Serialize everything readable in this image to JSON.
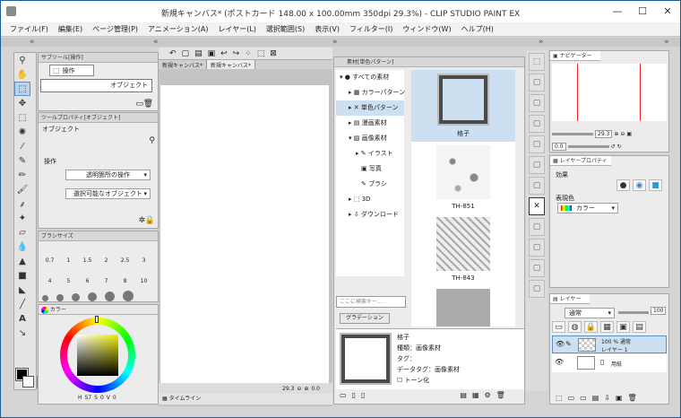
{
  "titlebar": {
    "title": "新規キャンバス* (ポストカード 148.00 x 100.00mm 350dpi 29.3%) - CLIP STUDIO PAINT EX",
    "minimize": "—",
    "maximize": "☐",
    "close": "✕"
  },
  "menu": [
    "ファイル(F)",
    "編集(E)",
    "ページ管理(P)",
    "アニメーション(A)",
    "レイヤー(L)",
    "選択範囲(S)",
    "表示(V)",
    "フィルター(I)",
    "ウィンドウ(W)",
    "ヘルプ(H)"
  ],
  "collapse": {
    "left": "«",
    "right": "»"
  },
  "subtool": {
    "tab_label": "サブツール[操作]",
    "group": "操作",
    "item": "オブジェクト"
  },
  "toolprop": {
    "tab_label": "ツールプロパティ[オブジェクト]",
    "name": "オブジェクト",
    "section": "操作",
    "dropdown1": "透明箇所の操作",
    "dropdown2": "選択可能なオブジェクト"
  },
  "brushsize": {
    "tab_label": "ブラシサイズ",
    "row1": [
      "0.7",
      "1",
      "1.5",
      "2",
      "2.5",
      "3"
    ],
    "row2": [
      "4",
      "5",
      "6",
      "7",
      "8",
      "10"
    ]
  },
  "color": {
    "tab_label": "カラー",
    "h": "H",
    "h_val": "57",
    "s": "S",
    "s_val": "0",
    "v": "V",
    "v_val": "0",
    "accent": "#eeee00"
  },
  "canvas": {
    "tabs": [
      "新規キャンバス*",
      "新規キャンバス*"
    ],
    "zoom": "29.3",
    "angle": "0.0",
    "timeline_label": "タイムライン"
  },
  "material": {
    "tab_label": "素材[単色パターン]",
    "tree": [
      "すべての素材",
      "カラーパターン",
      "単色パターン",
      "漫画素材",
      "画像素材",
      "イラスト",
      "写真",
      "ブラシ",
      "3D",
      "ダウンロード"
    ],
    "search_placeholder": "ここに検索キー...",
    "tag": "グラデーション",
    "thumbs": [
      "格子",
      "TH-851",
      "TH-843"
    ],
    "detail_name": "格子",
    "detail_kind": "種類：画像素材",
    "detail_tag": "タグ：",
    "detail_category": "データタグ：画像素材",
    "detail_tone": "トーン化"
  },
  "navigator": {
    "tab_label": "ナビゲーター",
    "zoom": "29.3",
    "angle": "0.0"
  },
  "layerprop": {
    "tab_label": "レイヤープロパティ",
    "effect": "効果",
    "display_color": "表現色",
    "color_mode": "カラー"
  },
  "layers": {
    "tab_label": "レイヤー",
    "blend": "通常",
    "opacity": "100",
    "items": [
      {
        "line1": "100 % 通常",
        "line2": "レイヤー 1"
      },
      {
        "line1": "",
        "line2": "用紙"
      }
    ]
  }
}
